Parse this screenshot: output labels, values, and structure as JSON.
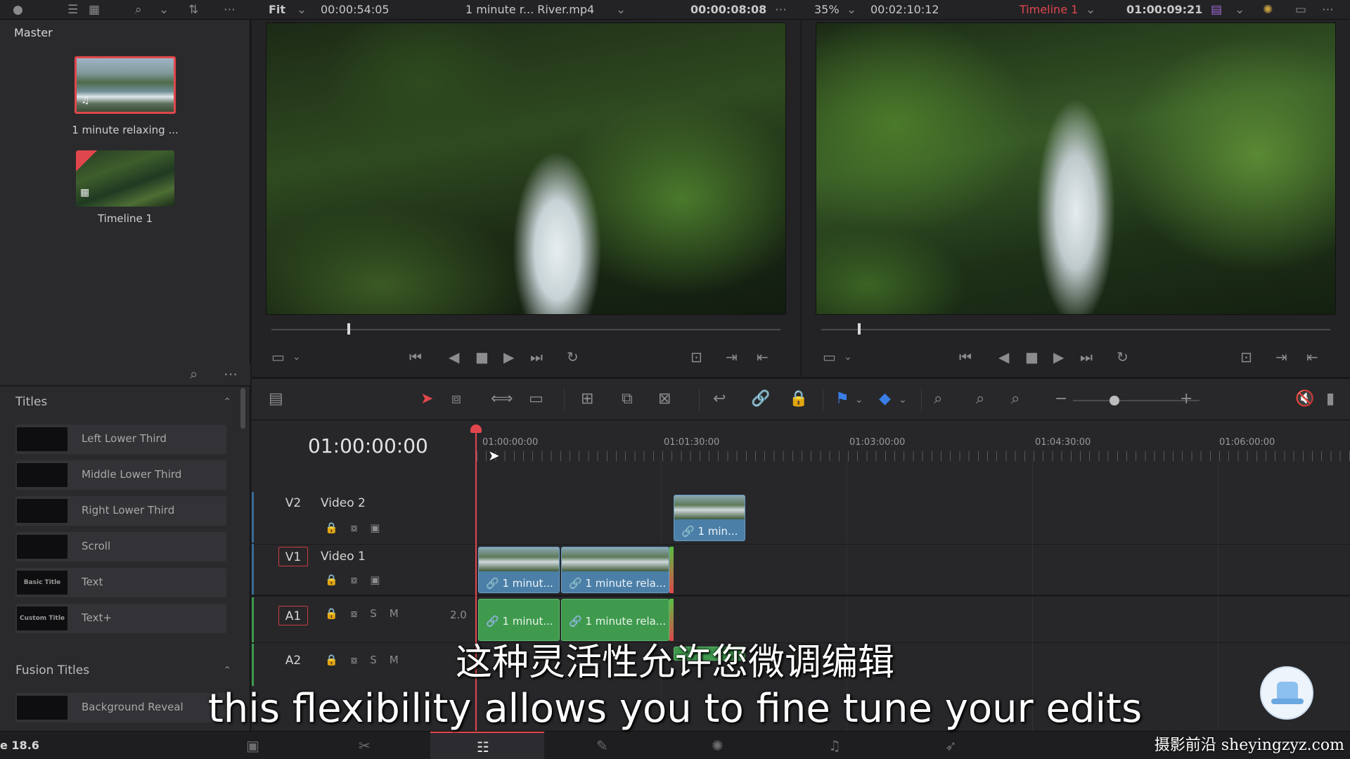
{
  "topbar": {
    "fit_label": "Fit",
    "source_tc_duration": "00:00:54:05",
    "clip_name": "1 minute r... River.mp4",
    "source_tc": "00:00:08:08",
    "zoom": "35%",
    "timeline_duration": "00:02:10:12",
    "timeline_name": "Timeline 1",
    "timeline_tc": "01:00:09:21"
  },
  "media_pool": {
    "bin": "Master",
    "items": [
      {
        "label": "1 minute relaxing ...",
        "icon": "music-note-icon"
      },
      {
        "label": "Timeline 1",
        "icon": "timeline-icon"
      }
    ]
  },
  "effects": {
    "titles_header": "Titles",
    "titles": [
      {
        "thumb": "",
        "label": "Left Lower Third"
      },
      {
        "thumb": "",
        "label": "Middle Lower Third"
      },
      {
        "thumb": "",
        "label": "Right Lower Third"
      },
      {
        "thumb": "",
        "label": "Scroll"
      },
      {
        "thumb": "Basic Title",
        "label": "Text"
      },
      {
        "thumb": "Custom Title",
        "label": "Text+"
      }
    ],
    "fusion_header": "Fusion Titles",
    "fusion": [
      {
        "thumb": "",
        "label": "Background Reveal"
      }
    ]
  },
  "timeline": {
    "timecode": "01:00:00:00",
    "ruler": [
      "01:00:00:00",
      "01:01:30:00",
      "01:03:00:00",
      "01:04:30:00",
      "01:06:00:00"
    ],
    "tracks": [
      {
        "id": "V2",
        "name": "Video 2"
      },
      {
        "id": "V1",
        "name": "Video 1"
      },
      {
        "id": "A1",
        "name": "",
        "volume": "2.0"
      },
      {
        "id": "A2",
        "name": ""
      }
    ],
    "clips": {
      "v2_clip": "1 min...",
      "v1_clip_a": "1 minut...",
      "v1_clip_b": "1 minute rela...",
      "a1_clip_a": "1 minut...",
      "a1_clip_b": "1 minute rela..."
    }
  },
  "pagebar": {
    "version": "e 18.6"
  },
  "overlay": {
    "subtitle_zh": "这种灵活性允许您微调编辑",
    "subtitle_en": "this flexibility allows you to fine tune your edits",
    "watermark": "摄影前沿 sheyingzyz.com"
  },
  "colors": {
    "accent_red": "#e0474c",
    "video_clip": "#4b7fa8",
    "audio_clip": "#3f9a4e"
  }
}
